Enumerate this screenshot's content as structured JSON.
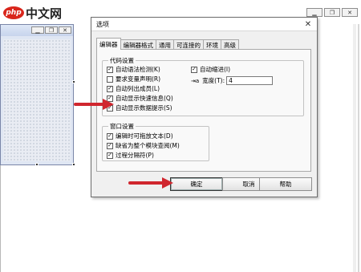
{
  "site_logo": {
    "badge": "php",
    "text": "中文网"
  },
  "dialog": {
    "title": "选项",
    "close_glyph": "✕",
    "tabs": [
      "编辑器",
      "编辑器格式",
      "通用",
      "可连接的",
      "环境",
      "高级"
    ],
    "active_tab": "编辑器",
    "code_settings": {
      "title": "代码设置",
      "options": [
        {
          "label": "自动语法检测(K)",
          "checked": true
        },
        {
          "label": "要求变量声明(R)",
          "checked": false
        },
        {
          "label": "自动列出成员(L)",
          "checked": true
        },
        {
          "label": "自动显示快速信息(Q)",
          "checked": true
        },
        {
          "label": "自动显示数据提示(S)",
          "checked": true
        }
      ],
      "auto_indent": {
        "label": "自动缩进(I)",
        "checked": true
      },
      "tab_width": {
        "label": "宽度(T):",
        "value": "4"
      }
    },
    "window_settings": {
      "title": "窗口设置",
      "options": [
        {
          "label": "编辑时可拖放文本(D)",
          "checked": true
        },
        {
          "label": "缺省为整个模块查阅(M)",
          "checked": true
        },
        {
          "label": "过程分隔符(P)",
          "checked": true
        }
      ]
    },
    "buttons": {
      "ok": "确定",
      "cancel": "取消",
      "help": "帮助"
    }
  },
  "colors": {
    "arrow": "#d0262e",
    "dialog_bg": "#f0f0f0"
  }
}
